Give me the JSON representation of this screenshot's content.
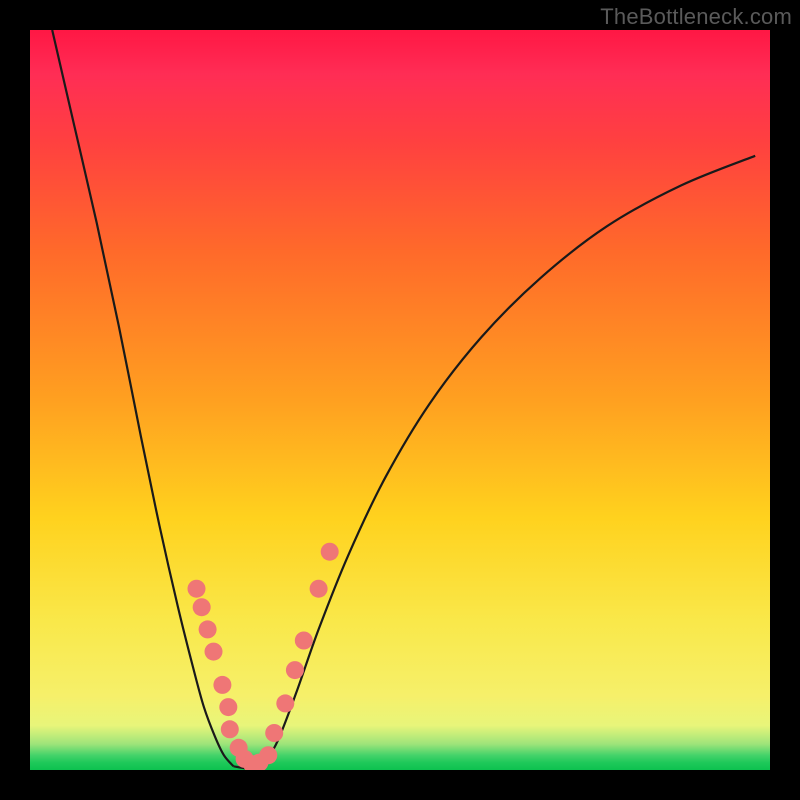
{
  "watermark": "TheBottleneck.com",
  "chart_data": {
    "type": "line",
    "title": "",
    "xlabel": "",
    "ylabel": "",
    "xlim": [
      0,
      1
    ],
    "ylim": [
      0,
      1
    ],
    "series": [
      {
        "name": "left-curve",
        "x": [
          0.03,
          0.06,
          0.09,
          0.12,
          0.15,
          0.175,
          0.2,
          0.22,
          0.235,
          0.25,
          0.262,
          0.275
        ],
        "y": [
          1.0,
          0.87,
          0.74,
          0.6,
          0.45,
          0.33,
          0.22,
          0.14,
          0.085,
          0.045,
          0.02,
          0.005
        ]
      },
      {
        "name": "minimum-flat",
        "x": [
          0.275,
          0.295,
          0.315
        ],
        "y": [
          0.005,
          0.002,
          0.005
        ]
      },
      {
        "name": "right-curve",
        "x": [
          0.315,
          0.335,
          0.36,
          0.39,
          0.43,
          0.48,
          0.54,
          0.61,
          0.69,
          0.78,
          0.88,
          0.98
        ],
        "y": [
          0.005,
          0.04,
          0.105,
          0.19,
          0.29,
          0.395,
          0.495,
          0.585,
          0.665,
          0.735,
          0.79,
          0.83
        ]
      }
    ],
    "scatter": {
      "name": "highlight-dots",
      "x": [
        0.225,
        0.232,
        0.24,
        0.248,
        0.26,
        0.268,
        0.27,
        0.282,
        0.29,
        0.3,
        0.31,
        0.322,
        0.33,
        0.345,
        0.358,
        0.37,
        0.39,
        0.405
      ],
      "y": [
        0.245,
        0.22,
        0.19,
        0.16,
        0.115,
        0.085,
        0.055,
        0.03,
        0.015,
        0.008,
        0.01,
        0.02,
        0.05,
        0.09,
        0.135,
        0.175,
        0.245,
        0.295
      ],
      "radius": 9
    },
    "background_gradient": {
      "top": "#ff1744",
      "mid": "#ffd21e",
      "bottom": "#0dc24f"
    }
  }
}
